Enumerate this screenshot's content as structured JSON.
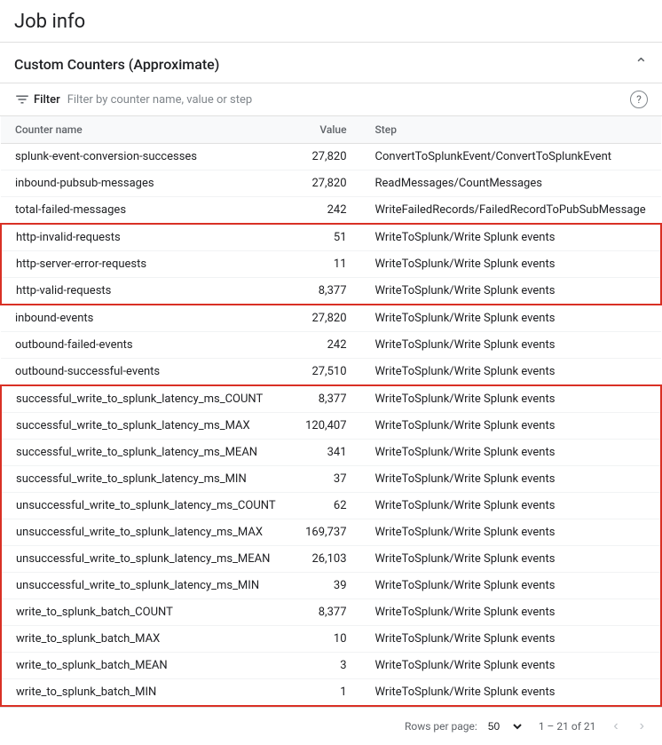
{
  "page": {
    "title": "Job info"
  },
  "section": {
    "title": "Custom Counters (Approximate)"
  },
  "filter": {
    "label": "Filter",
    "placeholder": "Filter by counter name, value or step"
  },
  "table": {
    "columns": [
      "Counter name",
      "Value",
      "Step"
    ],
    "rows": [
      {
        "name": "splunk-event-conversion-successes",
        "value": "27,820",
        "step": "ConvertToSplunkEvent/ConvertToSplunkEvent",
        "group": "normal"
      },
      {
        "name": "inbound-pubsub-messages",
        "value": "27,820",
        "step": "ReadMessages/CountMessages",
        "group": "normal"
      },
      {
        "name": "total-failed-messages",
        "value": "242",
        "step": "WriteFailedRecords/FailedRecordToPubSubMessage",
        "group": "normal"
      },
      {
        "name": "http-invalid-requests",
        "value": "51",
        "step": "WriteToSplunk/Write Splunk events",
        "group": "red-start"
      },
      {
        "name": "http-server-error-requests",
        "value": "11",
        "step": "WriteToSplunk/Write Splunk events",
        "group": "red-mid"
      },
      {
        "name": "http-valid-requests",
        "value": "8,377",
        "step": "WriteToSplunk/Write Splunk events",
        "group": "red-end"
      },
      {
        "name": "inbound-events",
        "value": "27,820",
        "step": "WriteToSplunk/Write Splunk events",
        "group": "normal"
      },
      {
        "name": "outbound-failed-events",
        "value": "242",
        "step": "WriteToSplunk/Write Splunk events",
        "group": "normal"
      },
      {
        "name": "outbound-successful-events",
        "value": "27,510",
        "step": "WriteToSplunk/Write Splunk events",
        "group": "normal"
      },
      {
        "name": "successful_write_to_splunk_latency_ms_COUNT",
        "value": "8,377",
        "step": "WriteToSplunk/Write Splunk events",
        "group": "red2-start"
      },
      {
        "name": "successful_write_to_splunk_latency_ms_MAX",
        "value": "120,407",
        "step": "WriteToSplunk/Write Splunk events",
        "group": "red2-mid"
      },
      {
        "name": "successful_write_to_splunk_latency_ms_MEAN",
        "value": "341",
        "step": "WriteToSplunk/Write Splunk events",
        "group": "red2-mid"
      },
      {
        "name": "successful_write_to_splunk_latency_ms_MIN",
        "value": "37",
        "step": "WriteToSplunk/Write Splunk events",
        "group": "red2-mid"
      },
      {
        "name": "unsuccessful_write_to_splunk_latency_ms_COUNT",
        "value": "62",
        "step": "WriteToSplunk/Write Splunk events",
        "group": "red2-mid"
      },
      {
        "name": "unsuccessful_write_to_splunk_latency_ms_MAX",
        "value": "169,737",
        "step": "WriteToSplunk/Write Splunk events",
        "group": "red2-mid"
      },
      {
        "name": "unsuccessful_write_to_splunk_latency_ms_MEAN",
        "value": "26,103",
        "step": "WriteToSplunk/Write Splunk events",
        "group": "red2-mid"
      },
      {
        "name": "unsuccessful_write_to_splunk_latency_ms_MIN",
        "value": "39",
        "step": "WriteToSplunk/Write Splunk events",
        "group": "red2-mid"
      },
      {
        "name": "write_to_splunk_batch_COUNT",
        "value": "8,377",
        "step": "WriteToSplunk/Write Splunk events",
        "group": "red2-mid"
      },
      {
        "name": "write_to_splunk_batch_MAX",
        "value": "10",
        "step": "WriteToSplunk/Write Splunk events",
        "group": "red2-mid"
      },
      {
        "name": "write_to_splunk_batch_MEAN",
        "value": "3",
        "step": "WriteToSplunk/Write Splunk events",
        "group": "red2-mid"
      },
      {
        "name": "write_to_splunk_batch_MIN",
        "value": "1",
        "step": "WriteToSplunk/Write Splunk events",
        "group": "red2-end"
      }
    ]
  },
  "footer": {
    "rows_per_page_label": "Rows per page:",
    "rows_per_page_value": "50",
    "page_range": "1 – 21 of 21"
  }
}
